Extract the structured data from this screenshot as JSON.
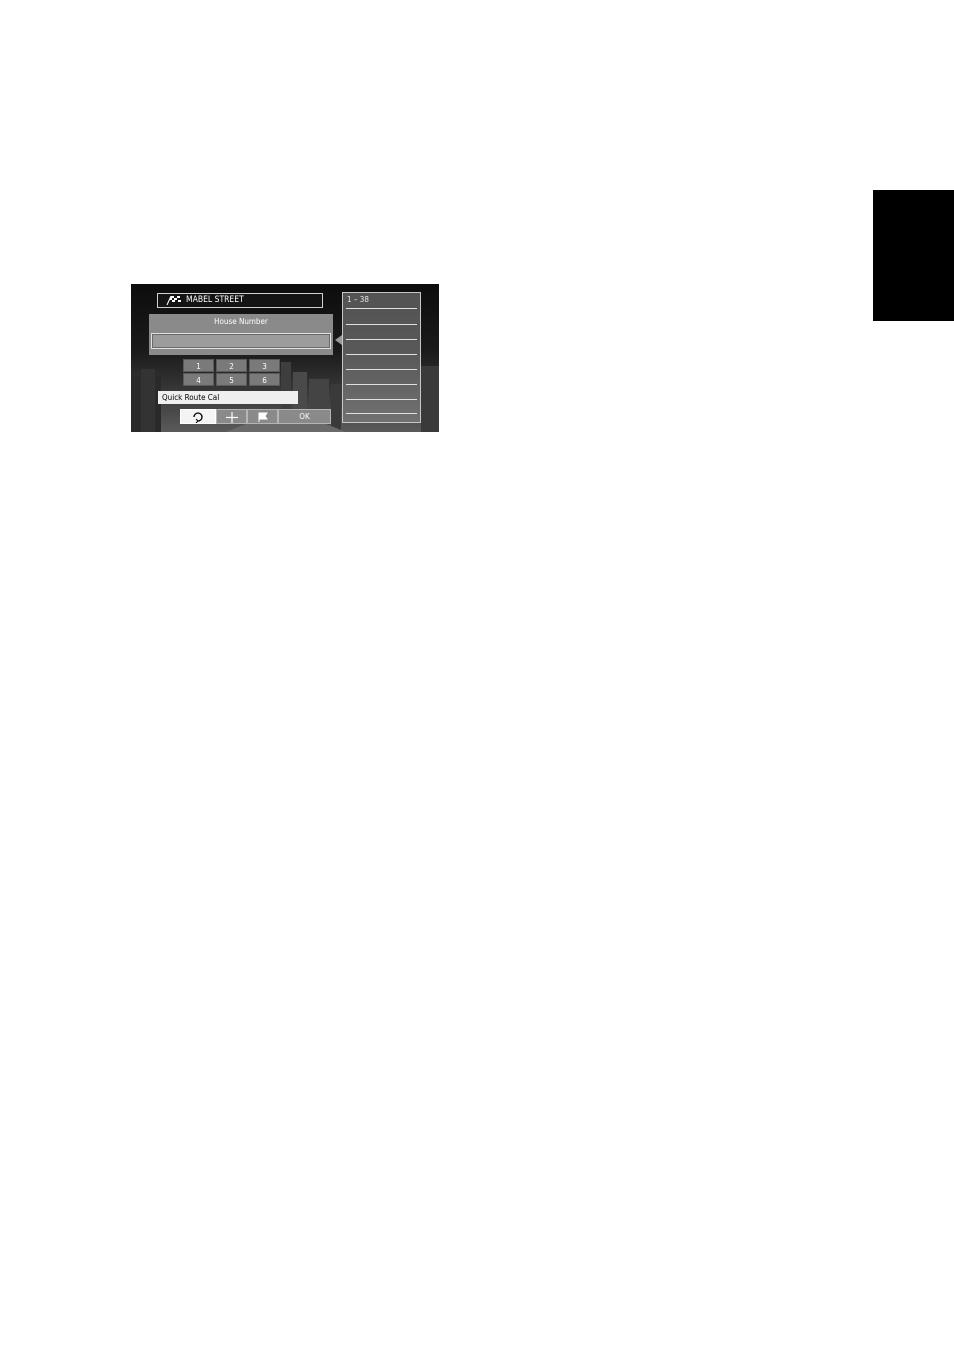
{
  "street": {
    "name": "MABEL STREET",
    "icon": "checkered-flag-icon"
  },
  "house_number": {
    "title": "House Number",
    "value": ""
  },
  "keypad": {
    "rows": [
      [
        "1",
        "2",
        "3"
      ],
      [
        "4",
        "5",
        "6"
      ]
    ]
  },
  "tooltip": {
    "text": "Quick Route Cal"
  },
  "bottom_bar": {
    "buttons": [
      {
        "label": "",
        "icon": "quick-route-icon"
      },
      {
        "label": "",
        "icon": "crosshair-icon"
      },
      {
        "label": "",
        "icon": "flag-icon"
      },
      {
        "label": "OK",
        "icon": ""
      }
    ]
  },
  "range_panel": {
    "range": "1 – 38"
  }
}
